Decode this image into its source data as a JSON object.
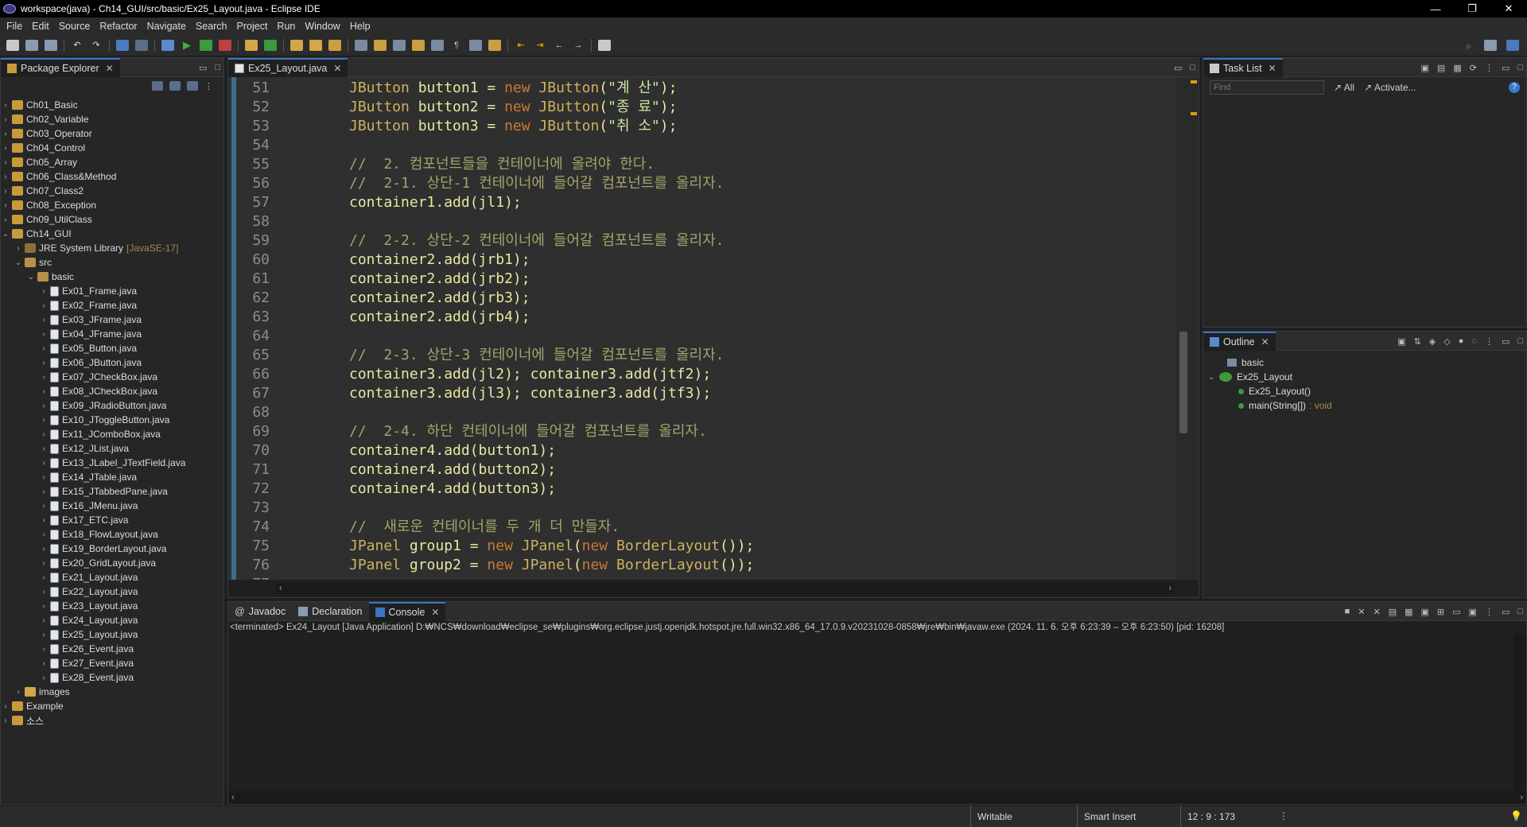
{
  "window": {
    "title": "workspace(java) - Ch14_GUI/src/basic/Ex25_Layout.java - Eclipse IDE",
    "controls": [
      "—",
      "❐",
      "✕"
    ]
  },
  "menu": [
    "File",
    "Edit",
    "Source",
    "Refactor",
    "Navigate",
    "Search",
    "Project",
    "Run",
    "Window",
    "Help"
  ],
  "package_explorer": {
    "tab_label": "Package Explorer",
    "projects_top": [
      "Ch01_Basic",
      "Ch02_Variable",
      "Ch03_Operator",
      "Ch04_Control",
      "Ch05_Array",
      "Ch06_Class&Method",
      "Ch07_Class2",
      "Ch08_Exception",
      "Ch09_UtilClass"
    ],
    "ch14": {
      "label": "Ch14_GUI",
      "jre_label": "JRE System Library",
      "jre_version": "[JavaSE-17]",
      "src_label": "src",
      "package_label": "basic",
      "files": [
        "Ex01_Frame.java",
        "Ex02_Frame.java",
        "Ex03_JFrame.java",
        "Ex04_JFrame.java",
        "Ex05_Button.java",
        "Ex06_JButton.java",
        "Ex07_JCheckBox.java",
        "Ex08_JCheckBox.java",
        "Ex09_JRadioButton.java",
        "Ex10_JToggleButton.java",
        "Ex11_JComboBox.java",
        "Ex12_JList.java",
        "Ex13_JLabel_JTextField.java",
        "Ex14_JTable.java",
        "Ex15_JTabbedPane.java",
        "Ex16_JMenu.java",
        "Ex17_ETC.java",
        "Ex18_FlowLayout.java",
        "Ex19_BorderLayout.java",
        "Ex20_GridLayout.java",
        "Ex21_Layout.java",
        "Ex22_Layout.java",
        "Ex23_Layout.java",
        "Ex24_Layout.java",
        "Ex25_Layout.java",
        "Ex26_Event.java",
        "Ex27_Event.java",
        "Ex28_Event.java"
      ],
      "images_label": "images"
    },
    "projects_bottom": [
      "Example",
      "소스"
    ]
  },
  "editor": {
    "tab_label": "Ex25_Layout.java",
    "lines": [
      {
        "n": "51",
        "segs": [
          [
            "type",
            "JButton"
          ],
          [
            "plain",
            " button1 = "
          ],
          [
            "kw",
            "new"
          ],
          [
            "type",
            " JButton"
          ],
          [
            "plain",
            "("
          ],
          [
            "str",
            "\"계 산\""
          ],
          [
            "plain",
            ");"
          ]
        ]
      },
      {
        "n": "52",
        "segs": [
          [
            "type",
            "JButton"
          ],
          [
            "plain",
            " button2 = "
          ],
          [
            "kw",
            "new"
          ],
          [
            "type",
            " JButton"
          ],
          [
            "plain",
            "("
          ],
          [
            "str",
            "\"종 료\""
          ],
          [
            "plain",
            ");"
          ]
        ]
      },
      {
        "n": "53",
        "segs": [
          [
            "type",
            "JButton"
          ],
          [
            "plain",
            " button3 = "
          ],
          [
            "kw",
            "new"
          ],
          [
            "type",
            " JButton"
          ],
          [
            "plain",
            "("
          ],
          [
            "str",
            "\"취 소\""
          ],
          [
            "plain",
            ");"
          ]
        ]
      },
      {
        "n": "54",
        "segs": []
      },
      {
        "n": "55",
        "segs": [
          [
            "cm",
            "//  2. 컴포넌트들을 컨테이너에 올려야 한다."
          ]
        ]
      },
      {
        "n": "56",
        "segs": [
          [
            "cm",
            "//  2-1. 상단-1 컨테이너에 들어갈 컴포넌트를 올리자."
          ]
        ]
      },
      {
        "n": "57",
        "segs": [
          [
            "plain",
            "container1.add(jl1);"
          ]
        ]
      },
      {
        "n": "58",
        "segs": []
      },
      {
        "n": "59",
        "segs": [
          [
            "cm",
            "//  2-2. 상단-2 컨테이너에 들어갈 컴포넌트를 올리자."
          ]
        ]
      },
      {
        "n": "60",
        "segs": [
          [
            "plain",
            "container2.add(jrb1);"
          ]
        ]
      },
      {
        "n": "61",
        "segs": [
          [
            "plain",
            "container2.add(jrb2);"
          ]
        ]
      },
      {
        "n": "62",
        "segs": [
          [
            "plain",
            "container2.add(jrb3);"
          ]
        ]
      },
      {
        "n": "63",
        "segs": [
          [
            "plain",
            "container2.add(jrb4);"
          ]
        ]
      },
      {
        "n": "64",
        "segs": []
      },
      {
        "n": "65",
        "segs": [
          [
            "cm",
            "//  2-3. 상단-3 컨테이너에 들어갈 컴포넌트를 올리자."
          ]
        ]
      },
      {
        "n": "66",
        "segs": [
          [
            "plain",
            "container3.add(jl2); container3.add(jtf2);"
          ]
        ]
      },
      {
        "n": "67",
        "segs": [
          [
            "plain",
            "container3.add(jl3); container3.add(jtf3);"
          ]
        ]
      },
      {
        "n": "68",
        "segs": []
      },
      {
        "n": "69",
        "segs": [
          [
            "cm",
            "//  2-4. 하단 컨테이너에 들어갈 컴포넌트를 올리자."
          ]
        ]
      },
      {
        "n": "70",
        "segs": [
          [
            "plain",
            "container4.add(button1);"
          ]
        ]
      },
      {
        "n": "71",
        "segs": [
          [
            "plain",
            "container4.add(button2);"
          ]
        ]
      },
      {
        "n": "72",
        "segs": [
          [
            "plain",
            "container4.add(button3);"
          ]
        ]
      },
      {
        "n": "73",
        "segs": []
      },
      {
        "n": "74",
        "segs": [
          [
            "cm",
            "//  새로운 컨테이너를 두 개 더 만들자."
          ]
        ]
      },
      {
        "n": "75",
        "segs": [
          [
            "type",
            "JPanel"
          ],
          [
            "plain",
            " group1 = "
          ],
          [
            "kw",
            "new"
          ],
          [
            "type",
            " JPanel"
          ],
          [
            "plain",
            "("
          ],
          [
            "kw",
            "new"
          ],
          [
            "type",
            " BorderLayout"
          ],
          [
            "plain",
            "());"
          ]
        ]
      },
      {
        "n": "76",
        "segs": [
          [
            "type",
            "JPanel"
          ],
          [
            "plain",
            " group2 = "
          ],
          [
            "kw",
            "new"
          ],
          [
            "type",
            " JPanel"
          ],
          [
            "plain",
            "("
          ],
          [
            "kw",
            "new"
          ],
          [
            "type",
            " BorderLayout"
          ],
          [
            "plain",
            "());"
          ]
        ]
      },
      {
        "n": "77",
        "segs": []
      }
    ]
  },
  "task_list": {
    "tab_label": "Task List",
    "find_placeholder": "Find",
    "all_label": "All",
    "activate_label": "Activate..."
  },
  "outline": {
    "tab_label": "Outline",
    "package_label": "basic",
    "class_label": "Ex25_Layout",
    "constructor_label": "Ex25_Layout()",
    "method_label": "main(String[])",
    "method_return": ": void"
  },
  "console": {
    "tabs": [
      "Javadoc",
      "Declaration",
      "Console"
    ],
    "status": "<terminated> Ex24_Layout [Java Application] D:₩NCS₩download₩eclipse_se₩plugins₩org.eclipse.justj.openjdk.hotspot.jre.full.win32.x86_64_17.0.9.v20231028-0858₩jre₩bin₩javaw.exe  (2024. 11. 6. 오후 6:23:39 – 오후 6:23:50) [pid: 16208]"
  },
  "statusbar": {
    "writable": "Writable",
    "insert_mode": "Smart Insert",
    "position": "12 : 9 : 173"
  },
  "colors": {
    "accent": "#3a74c4",
    "editor_bg": "#2f2f2f"
  }
}
